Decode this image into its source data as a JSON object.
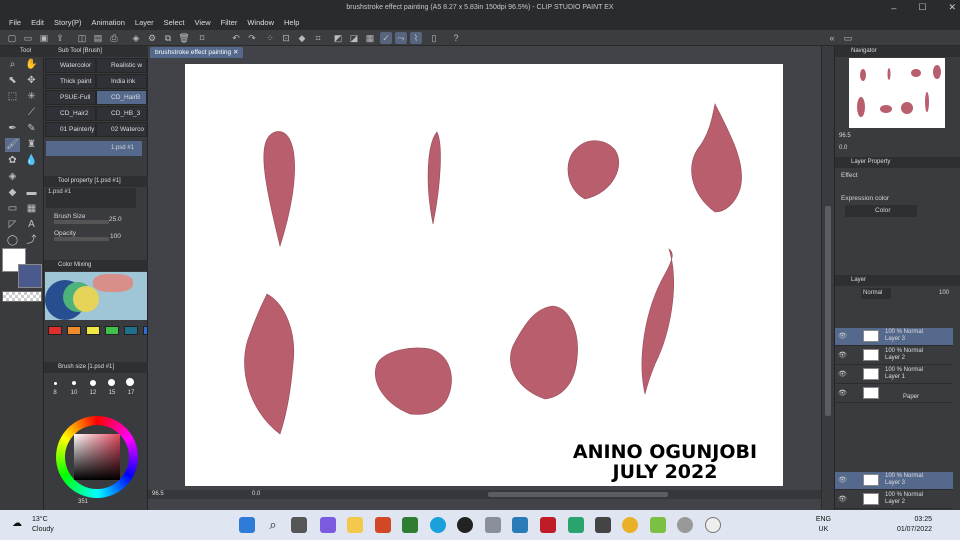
{
  "titlebar": {
    "title": "brushstroke effect painting (A5 8.27 x 5.83in 150dpi 96.5%) - CLIP STUDIO PAINT EX",
    "min": "–",
    "max": "☐",
    "close": "✕"
  },
  "menu": [
    "File",
    "Edit",
    "Story(P)",
    "Animation",
    "Layer",
    "Select",
    "View",
    "Filter",
    "Window",
    "Help"
  ],
  "doc_tab": {
    "label": "brushstroke effect painting",
    "close": "✕"
  },
  "sub_tool": {
    "panel_tabs": [
      "Tool",
      "Sub Tool [Brush]"
    ],
    "items": [
      "Watercolor",
      "Realistic w",
      "Thick paint",
      "India ink",
      "PSUE-Full",
      "CD_HairB",
      "CD_Hair2",
      "CD_HB_3",
      "01 Painterly",
      "02 Waterco"
    ],
    "selected": "CD_HairB",
    "preset_label": "1.psd #1"
  },
  "tool_property": {
    "title": "Tool property [1.psd #1]",
    "preset": "1.psd #1",
    "brush_size_label": "Brush Size",
    "brush_size_value": "25.0",
    "opacity_label": "Opacity",
    "opacity_value": "100"
  },
  "color_mixing": {
    "title": "Color Mixing",
    "swatches": [
      "#e02d2d",
      "#ef8b2a",
      "#efe840",
      "#3fc24a",
      "#1f6e8a",
      "#2f6cd6"
    ]
  },
  "brush_size_panel": {
    "title": "Brush size [1.psd #1]",
    "sizes": [
      "8",
      "10",
      "12",
      "15",
      "17"
    ]
  },
  "color_wheel": {
    "main_color": "#ffffff",
    "sub_color": "#4a5a8c"
  },
  "status_bottom": {
    "left": "351",
    "zoom": "96.5",
    "rotation": "0.0"
  },
  "canvas": {
    "stroke_color": "#b85e6c",
    "watermark_line1": "ANINO OGUNJOBI",
    "watermark_line2": "JULY 2022"
  },
  "navigator": {
    "title": "Navigator",
    "zoom": "96.5",
    "rotate": "0.0"
  },
  "layer_property": {
    "title": "Layer Property",
    "effect_label": "Effect",
    "expression_label": "Expression color",
    "color_value": "Color"
  },
  "layer_panel": {
    "title": "Layer",
    "blend": "Normal",
    "opacity": "100",
    "layers": [
      {
        "mode": "100 % Normal",
        "name": "Layer 3",
        "selected": true
      },
      {
        "mode": "100 % Normal",
        "name": "Layer 2",
        "selected": false
      },
      {
        "mode": "100 % Normal",
        "name": "Layer 1",
        "selected": false
      },
      {
        "mode": "",
        "name": "Paper",
        "selected": false
      }
    ],
    "secondary": [
      {
        "mode": "100 % Normal",
        "name": "Layer 3"
      },
      {
        "mode": "100 % Normal",
        "name": "Layer 2"
      }
    ]
  },
  "taskbar": {
    "weather_temp": "13°C",
    "weather_desc": "Cloudy",
    "lang_line1": "ENG",
    "lang_line2": "UK",
    "time": "03:25",
    "date": "01/07/2022"
  }
}
